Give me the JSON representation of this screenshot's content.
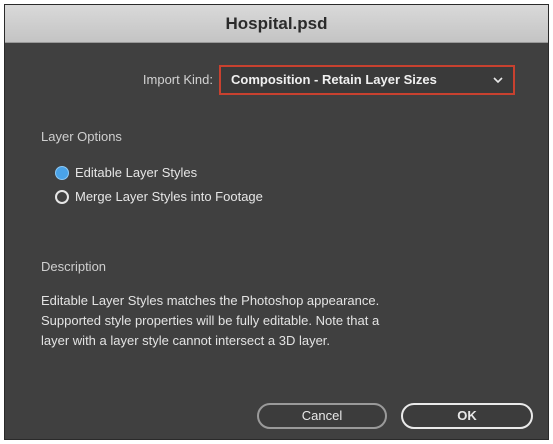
{
  "window": {
    "title": "Hospital.psd"
  },
  "import": {
    "label": "Import Kind:",
    "selected": "Composition - Retain Layer Sizes",
    "dropdown_icon": "chevron-down-icon",
    "highlight_color": "#c8412f"
  },
  "layer_options": {
    "heading": "Layer Options",
    "options": [
      {
        "label": "Editable Layer Styles",
        "selected": true
      },
      {
        "label": "Merge Layer Styles into Footage",
        "selected": false
      }
    ],
    "selected_color": "#4aa3e8"
  },
  "description": {
    "heading": "Description",
    "lines": [
      "Editable Layer Styles matches the Photoshop appearance.",
      "Supported style properties will be fully editable. Note that a",
      "layer with a layer style cannot intersect a 3D layer."
    ]
  },
  "buttons": {
    "cancel": "Cancel",
    "ok": "OK"
  },
  "colors": {
    "dialog_bg": "#404040",
    "titlebar_bg": "#cccccc"
  }
}
